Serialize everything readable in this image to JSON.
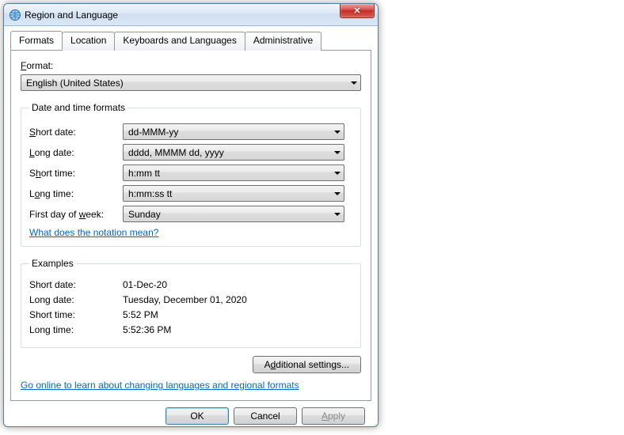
{
  "window": {
    "title": "Region and Language"
  },
  "tabs": {
    "formats": "Formats",
    "location": "Location",
    "keyboards": "Keyboards and Languages",
    "administrative": "Administrative"
  },
  "format_section": {
    "label_prefix": "F",
    "label_text": "ormat:",
    "selected": "English (United States)"
  },
  "dt_group": {
    "legend": "Date and time formats",
    "short_date_prefix": "S",
    "short_date_label": "hort date:",
    "short_date_value": "dd-MMM-yy",
    "long_date_prefix": "L",
    "long_date_label": "ong date:",
    "long_date_value": "dddd, MMMM dd, yyyy",
    "short_time_label_a": "S",
    "short_time_label_b": "h",
    "short_time_label_c": "ort time:",
    "short_time_value": "h:mm tt",
    "long_time_label_a": "L",
    "long_time_label_b": "o",
    "long_time_label_c": "ng time:",
    "long_time_value": "h:mm:ss tt",
    "first_day_label_a": "First day of ",
    "first_day_label_b": "w",
    "first_day_label_c": "eek:",
    "first_day_value": "Sunday",
    "notation_link": "What does the notation mean?"
  },
  "examples_group": {
    "legend": "Examples",
    "short_date_label": "Short date:",
    "short_date_value": "01-Dec-20",
    "long_date_label": "Long date:",
    "long_date_value": "Tuesday, December 01, 2020",
    "short_time_label": "Short time:",
    "short_time_value": "5:52 PM",
    "long_time_label": "Long time:",
    "long_time_value": "5:52:36 PM"
  },
  "additional_settings_a": "A",
  "additional_settings_b": "d",
  "additional_settings_c": "ditional settings...",
  "online_link": "Go online to learn about changing languages and regional formats",
  "buttons": {
    "ok": "OK",
    "cancel": "Cancel",
    "apply_a": "A",
    "apply_b": "pply"
  }
}
